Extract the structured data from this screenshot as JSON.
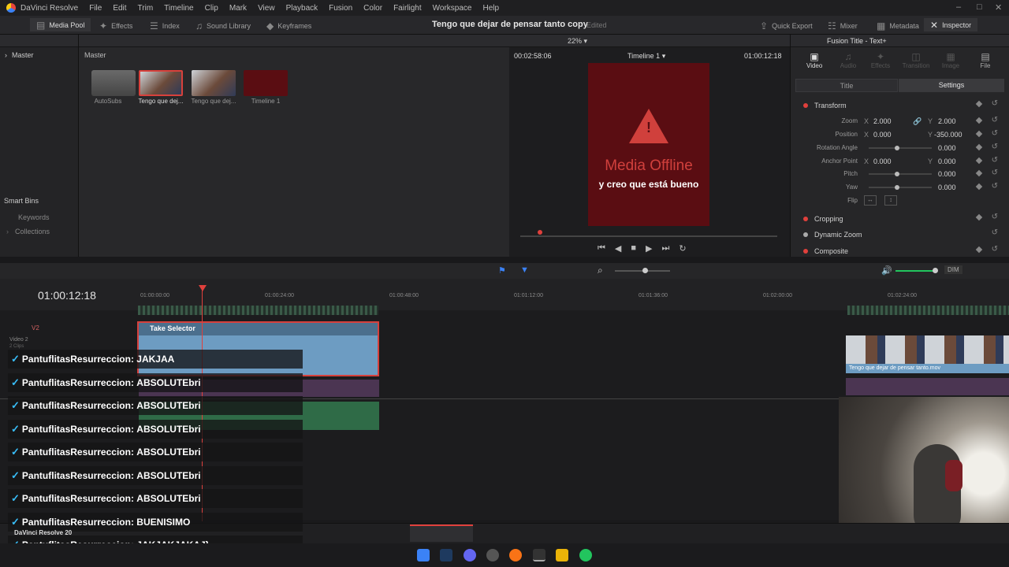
{
  "menubar": {
    "app_name": "DaVinci Resolve",
    "items": [
      "File",
      "Edit",
      "Trim",
      "Timeline",
      "Clip",
      "Mark",
      "View",
      "Playback",
      "Fusion",
      "Color",
      "Fairlight",
      "Workspace",
      "Help"
    ]
  },
  "toolbar": {
    "media_pool": "Media Pool",
    "effects": "Effects",
    "index": "Index",
    "sound_library": "Sound Library",
    "keyframes": "Keyframes",
    "project_title": "Tengo que dejar de pensar tanto copy",
    "edited": "Edited",
    "quick_export": "Quick Export",
    "mixer": "Mixer",
    "metadata": "Metadata",
    "inspector": "Inspector"
  },
  "bins": {
    "master": "Master",
    "smart_bins": "Smart Bins",
    "keywords": "Keywords",
    "collections": "Collections"
  },
  "pool": {
    "header": "Master",
    "clips": [
      {
        "label": "AutoSubs"
      },
      {
        "label": "Tengo que dej..."
      },
      {
        "label": "Tengo que dej..."
      },
      {
        "label": "Timeline 1"
      }
    ]
  },
  "viewer": {
    "zoom": "22%",
    "timecode_left": "00:02:58:06",
    "timeline_name": "Timeline 1",
    "timecode_right": "01:00:12:18",
    "offline_text": "Media Offline",
    "subtitle": "y creo que está bueno"
  },
  "inspector": {
    "title": "Fusion Title - Text+",
    "tabs": [
      "Video",
      "Audio",
      "Effects",
      "Transition",
      "Image",
      "File"
    ],
    "subtabs": [
      "Title",
      "Settings"
    ],
    "transform": "Transform",
    "zoom_label": "Zoom",
    "zoom_x": "2.000",
    "zoom_y": "2.000",
    "position_label": "Position",
    "position_x": "0.000",
    "position_y": "-350.000",
    "rotation_label": "Rotation Angle",
    "rotation": "0.000",
    "anchor_label": "Anchor Point",
    "anchor_x": "0.000",
    "anchor_y": "0.000",
    "pitch_label": "Pitch",
    "pitch": "0.000",
    "yaw_label": "Yaw",
    "yaw": "0.000",
    "flip_label": "Flip",
    "x": "X",
    "y": "Y",
    "cropping": "Cropping",
    "dynamic_zoom": "Dynamic Zoom",
    "composite": "Composite"
  },
  "timeline": {
    "timecode": "01:00:12:18",
    "ruler": [
      "01:00:00:00",
      "01:00:24:00",
      "01:00:48:00",
      "01:01:12:00",
      "01:01:36:00",
      "01:02:00:00",
      "01:02:24:00"
    ],
    "track_v2": "V2",
    "track_video2": "Video 2",
    "track_sub": "2 Clips",
    "take_selector": "Take Selector",
    "clip_name": "Tengo que dejar de pensar tanto.mov",
    "dim": "DIM"
  },
  "chat": [
    {
      "user": "PantuflitasResurreccion:",
      "msg": "JAKJAA"
    },
    {
      "user": "PantuflitasResurreccion:",
      "msg": "ABSOLUTEbri"
    },
    {
      "user": "PantuflitasResurreccion:",
      "msg": "ABSOLUTEbri"
    },
    {
      "user": "PantuflitasResurreccion:",
      "msg": "ABSOLUTEbri"
    },
    {
      "user": "PantuflitasResurreccion:",
      "msg": "ABSOLUTEbri"
    },
    {
      "user": "PantuflitasResurreccion:",
      "msg": "ABSOLUTEbri"
    },
    {
      "user": "PantuflitasResurreccion:",
      "msg": "ABSOLUTEbri"
    },
    {
      "user": "PantuflitasResurreccion:",
      "msg": "BUENISIMO"
    },
    {
      "user": "PantuflitasResurreccion:",
      "msg": "JAKJAKJAKAJ}"
    }
  ],
  "footer": {
    "app_version": "DaVinci Resolve 20"
  },
  "colors": {
    "accent_red": "#e0403c",
    "offline_bg": "#5a0d12",
    "chat_icon": "#38bdf8",
    "clip_blue": "#6d9cc2"
  }
}
